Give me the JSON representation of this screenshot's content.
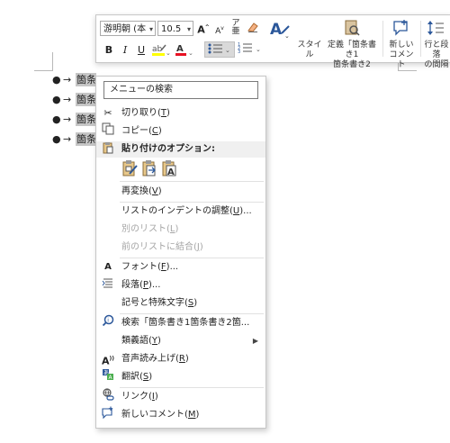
{
  "document": {
    "items": [
      {
        "bullet": "●",
        "arrow": "→",
        "text": "箇条"
      },
      {
        "bullet": "●",
        "arrow": "→",
        "text": "箇条"
      },
      {
        "bullet": "●",
        "arrow": "→",
        "text": "箇条"
      },
      {
        "bullet": "●",
        "arrow": "→",
        "text": "箇条"
      }
    ]
  },
  "mini_toolbar": {
    "font_name": "游明朝 (本",
    "font_size": "10.5",
    "grow_font": "A",
    "shrink_font": "A",
    "bold": "B",
    "italic": "I",
    "underline": "U",
    "styles_label": "スタイル",
    "define_line1": "定義「箇条書き1",
    "define_line2": "箇条書き2",
    "new_comment_line1": "新しい",
    "new_comment_line2": "コメント",
    "spacing_line1": "行と段落",
    "spacing_line2": "の間隔",
    "highlight_color": "#ffff00",
    "font_color": "#e81123"
  },
  "context_menu": {
    "search_text": "メニューの検索",
    "cut": {
      "label": "切り取り(",
      "key": "T",
      "tail": ")"
    },
    "copy": {
      "label": "コピー(",
      "key": "C",
      "tail": ")"
    },
    "paste_header": "貼り付けのオプション:",
    "reconvert": {
      "label": "再変換(",
      "key": "V",
      "tail": ")"
    },
    "indent": {
      "label": "リストのインデントの調整(",
      "key": "U",
      "tail": ")..."
    },
    "separate_list": {
      "label": "別のリスト(",
      "key": "L",
      "tail": ")"
    },
    "join_list": {
      "label": "前のリストに結合(",
      "key": "J",
      "tail": ")"
    },
    "font": {
      "label": "フォント(",
      "key": "F",
      "tail": ")..."
    },
    "paragraph": {
      "label": "段落(",
      "key": "P",
      "tail": ")..."
    },
    "symbols": {
      "label": "記号と特殊文字(",
      "key": "S",
      "tail": ")"
    },
    "lookup": "検索「箇条書き1箇条書き2箇...",
    "synonyms": {
      "label": "類義語(",
      "key": "Y",
      "tail": ")"
    },
    "read_aloud": {
      "label": "音声読み上げ(",
      "key": "R",
      "tail": ")"
    },
    "translate": {
      "label": "翻訳(",
      "key": "S",
      "tail": ")"
    },
    "link": {
      "label": "リンク(",
      "key": "I",
      "tail": ")"
    },
    "new_comment": {
      "label": "新しいコメント(",
      "key": "M",
      "tail": ")"
    }
  }
}
